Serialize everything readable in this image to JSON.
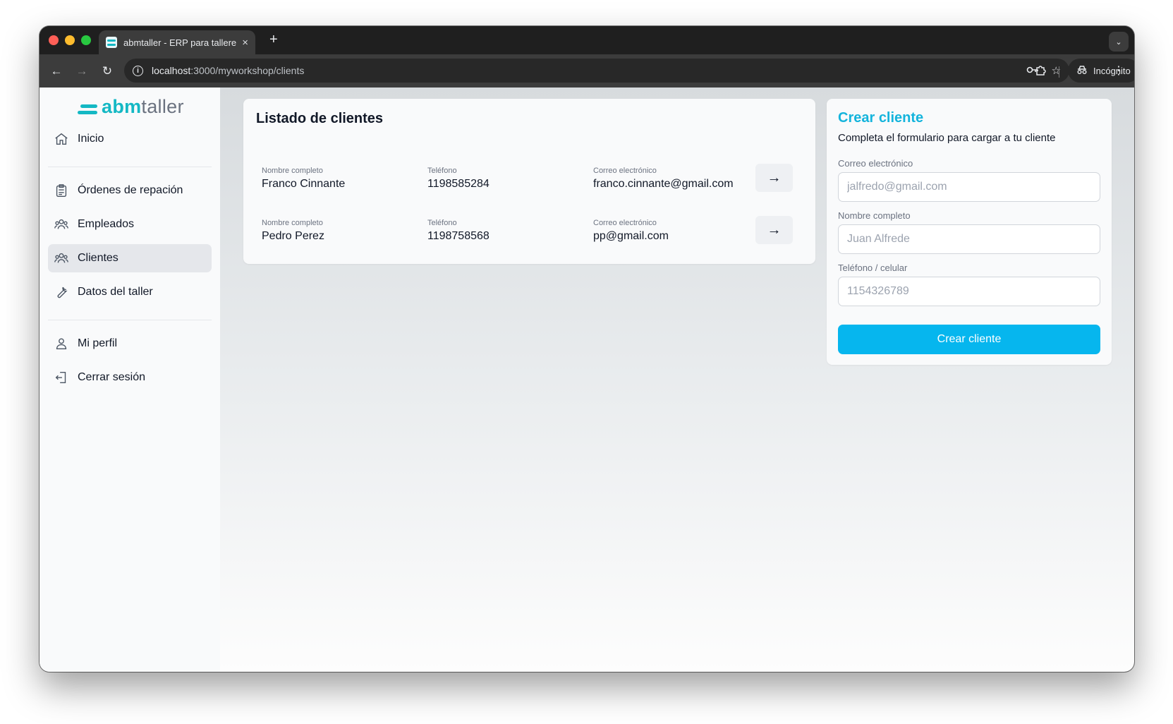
{
  "browser": {
    "tab_title": "abmtaller - ERP para talleres",
    "url_host": "localhost",
    "url_path": ":3000/myworkshop/clients",
    "incognito_label": "Incógnito"
  },
  "logo": {
    "bold": "abm",
    "light": "taller"
  },
  "sidebar": {
    "items": [
      {
        "label": "Inicio",
        "icon": "home-icon"
      },
      {
        "label": "Órdenes de repación",
        "icon": "clipboard-icon"
      },
      {
        "label": "Empleados",
        "icon": "users-icon"
      },
      {
        "label": "Clientes",
        "icon": "users-icon",
        "active": true
      },
      {
        "label": "Datos del taller",
        "icon": "wrench-icon"
      },
      {
        "label": "Mi perfil",
        "icon": "user-icon"
      },
      {
        "label": "Cerrar sesión",
        "icon": "logout-icon"
      }
    ]
  },
  "clients_list": {
    "title": "Listado de clientes",
    "columns": {
      "name": "Nombre completo",
      "phone": "Teléfono",
      "email": "Correo electrónico"
    },
    "rows": [
      {
        "name": "Franco Cinnante",
        "phone": "1198585284",
        "email": "franco.cinnante@gmail.com"
      },
      {
        "name": "Pedro Perez",
        "phone": "1198758568",
        "email": "pp@gmail.com"
      }
    ],
    "arrow": "→"
  },
  "create_form": {
    "title": "Crear cliente",
    "subtitle": "Completa el formulario para cargar a tu cliente",
    "email_label": "Correo electrónico",
    "email_placeholder": "jalfredo@gmail.com",
    "name_label": "Nombre completo",
    "name_placeholder": "Juan Alfrede",
    "phone_label": "Teléfono / celular",
    "phone_placeholder": "1154326789",
    "submit_label": "Crear cliente"
  },
  "colors": {
    "brand": "#14b8c4",
    "accent": "#06b6ee",
    "title_accent": "#14b4dc"
  }
}
